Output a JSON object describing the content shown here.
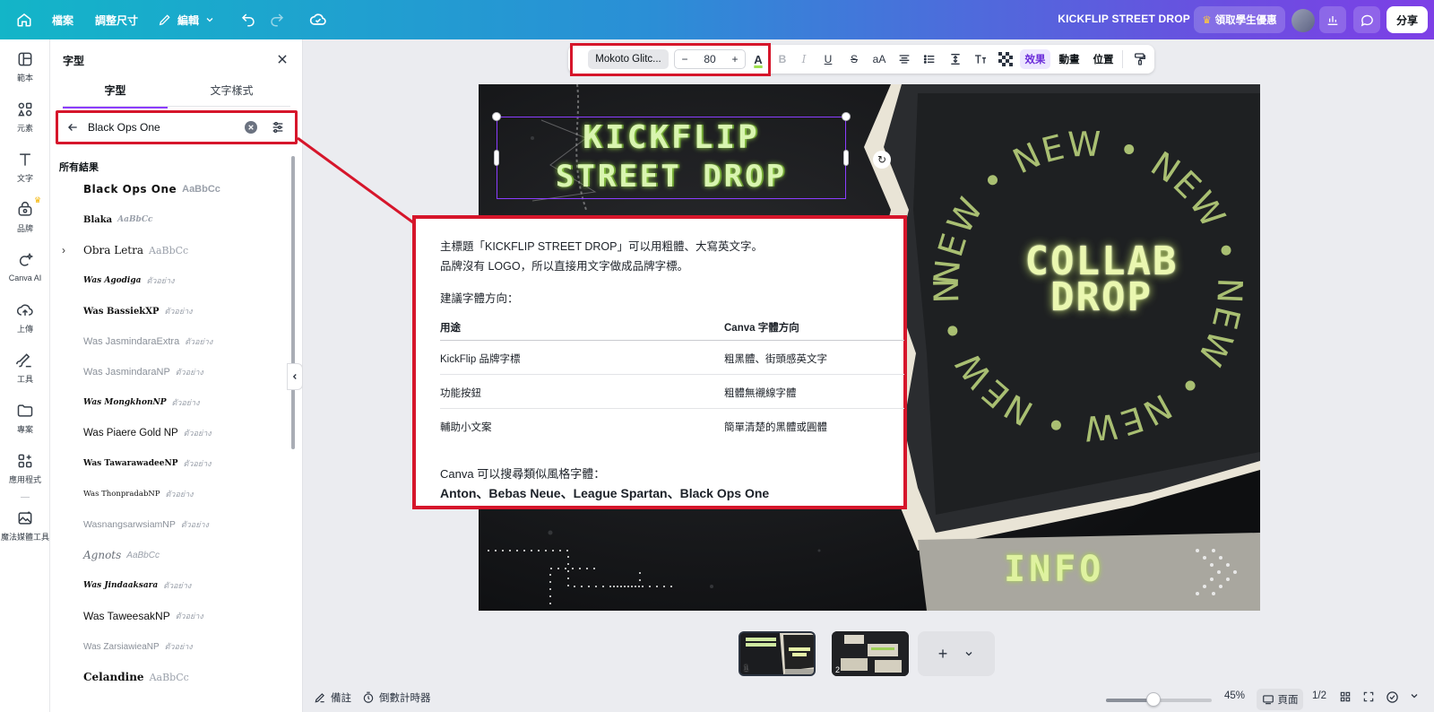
{
  "topbar": {
    "file_label": "檔案",
    "resize_label": "調整尺寸",
    "edit_label": "編輯",
    "design_title": "KICKFLIP STREET DROP",
    "promo_label": "領取學生優惠",
    "share_label": "分享"
  },
  "rail": {
    "items": [
      {
        "label": "範本",
        "icon": "template-icon"
      },
      {
        "label": "元素",
        "icon": "elements-icon"
      },
      {
        "label": "文字",
        "icon": "text-icon"
      },
      {
        "label": "品牌",
        "icon": "brand-icon"
      },
      {
        "label": "Canva AI",
        "icon": "canva-ai-icon"
      },
      {
        "label": "上傳",
        "icon": "upload-icon"
      },
      {
        "label": "工具",
        "icon": "tools-icon"
      },
      {
        "label": "專案",
        "icon": "projects-icon"
      },
      {
        "label": "應用程式",
        "icon": "apps-icon"
      },
      {
        "label": "魔法媒體工具",
        "icon": "magic-media-icon"
      }
    ]
  },
  "panel": {
    "title": "字型",
    "tabs": [
      "字型",
      "文字樣式"
    ],
    "search_value": "Black Ops One",
    "results_label": "所有結果",
    "fonts": [
      {
        "name": "Black Ops One",
        "sample": "AaBbCc"
      },
      {
        "name": "Blaka",
        "sample": "AaBbCc"
      },
      {
        "name": "Obra Letra",
        "sample": "AaBbCc"
      },
      {
        "name": "Was Agodiga",
        "sample": "ตัวอย่าง"
      },
      {
        "name": "Was BassiekXP",
        "sample": "ตัวอย่าง"
      },
      {
        "name": "Was JasmindaraExtra",
        "sample": "ตัวอย่าง"
      },
      {
        "name": "Was JasmindaraNP",
        "sample": "ตัวอย่าง"
      },
      {
        "name": "Was MongkhonNP",
        "sample": "ตัวอย่าง"
      },
      {
        "name": "Was Piaere Gold NP",
        "sample": "ตัวอย่าง"
      },
      {
        "name": "Was TawarawadeeNP",
        "sample": "ตัวอย่าง"
      },
      {
        "name": "Was ThonpradabNP",
        "sample": "ตัวอย่าง"
      },
      {
        "name": "WasnangsarwsiamNP",
        "sample": "ตัวอย่าง"
      },
      {
        "name": "Agnots",
        "sample": "AaBbCc"
      },
      {
        "name": "Was Jindaaksara",
        "sample": "ตัวอย่าง"
      },
      {
        "name": "Was TaweesakNP",
        "sample": "ตัวอย่าง"
      },
      {
        "name": "Was ZarsiawieaNP",
        "sample": "ตัวอย่าง"
      },
      {
        "name": "Celandine",
        "sample": "AaBbCc"
      }
    ]
  },
  "text_toolbar": {
    "font_family": "Mokoto Glitc...",
    "font_size": "80",
    "minus": "−",
    "plus": "+",
    "effects_label": "效果",
    "animate_label": "動畫",
    "position_label": "位置"
  },
  "canvas": {
    "headline_line1": "KICKFLIP",
    "headline_line2": "STREET DROP",
    "collab_line1": "COLLAB",
    "collab_line2": "DROP",
    "ring_word": "NEW",
    "info_label": "INFO"
  },
  "note": {
    "line1": "主標題「KICKFLIP STREET DROP」可以用粗體、大寫英文字。",
    "line2": "品牌沒有 LOGO，所以直接用文字做成品牌字標。",
    "line3": "建議字體方向：",
    "table_head": [
      "用途",
      "Canva 字體方向"
    ],
    "table_rows": [
      [
        "KickFlip 品牌字標",
        "粗黑體、街頭感英文字"
      ],
      [
        "功能按鈕",
        "粗體無襯線字體"
      ],
      [
        "輔助小文案",
        "簡單清楚的黑體或圓體"
      ]
    ],
    "line4": "Canva 可以搜尋類似風格字體：",
    "line5": "Anton、Bebas Neue、League Spartan、Black Ops One"
  },
  "pages": {
    "thumb_numbers": [
      "1",
      "2"
    ]
  },
  "bottombar": {
    "notes_label": "備註",
    "timer_label": "倒數計時器",
    "zoom_value": 0.45,
    "zoom_label": "45%",
    "pages_label": "頁面",
    "page_count": "1/2"
  },
  "colors": {
    "accent": "#8b3dff",
    "highlight_red": "#d6162b",
    "neon_green": "#d9f5b0"
  }
}
